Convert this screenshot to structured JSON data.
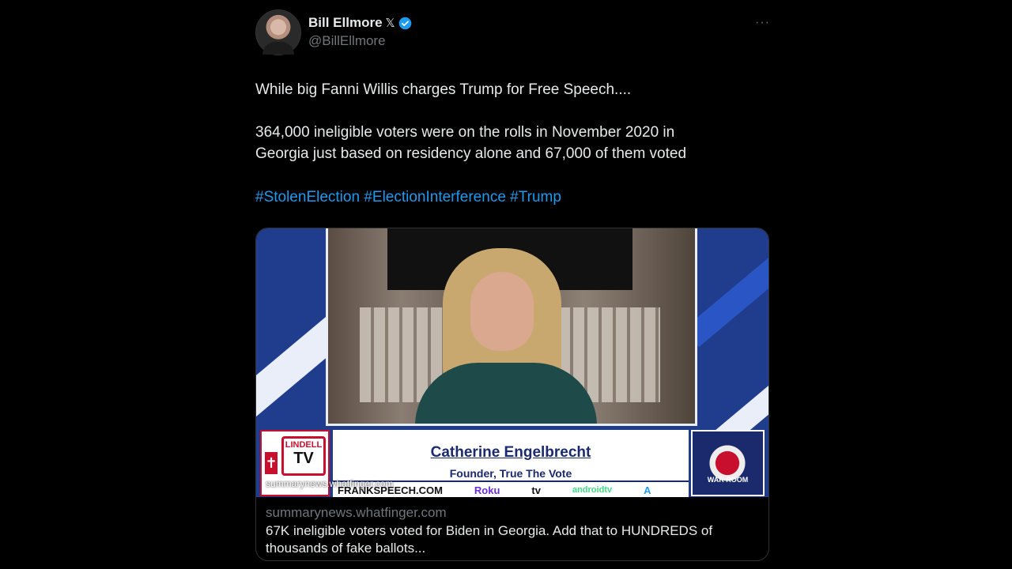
{
  "tweet": {
    "author": {
      "display_name": "Bill Ellmore",
      "handle": "@BillEllmore",
      "x_badge": "𝕏"
    },
    "more_icon": "···",
    "text": {
      "line1": "While big Fanni Willis charges Trump for Free Speech....",
      "line2a": "364,000 ineligible voters were on the rolls in November 2020 in",
      "line2b": "Georgia just based on residency alone and 67,000 of them voted"
    },
    "hashtags": [
      "#StolenElection",
      "#ElectionInterference",
      "#Trump"
    ]
  },
  "card": {
    "video": {
      "logo_top": "LINDELL",
      "logo_bottom": "TV",
      "lower_third_name": "Catherine Engelbrecht",
      "lower_third_title": "Founder, True The Vote",
      "ticker_frank": "FRANKSPEECH.COM",
      "ticker_roku": "Roku",
      "ticker_tv": "tv",
      "ticker_android": "androidtv",
      "ticker_app": "A",
      "warroom": "WAR ROOM",
      "overlay_domain": "summarynews.whatfinger.com"
    },
    "domain": "summarynews.whatfinger.com",
    "description": "67K ineligible voters voted for Biden in Georgia. Add that to HUNDREDS of thousands of fake ballots..."
  },
  "colors": {
    "link": "#1d9bf0",
    "background": "#000000",
    "muted": "#71767b",
    "text": "#e7e9ea"
  }
}
